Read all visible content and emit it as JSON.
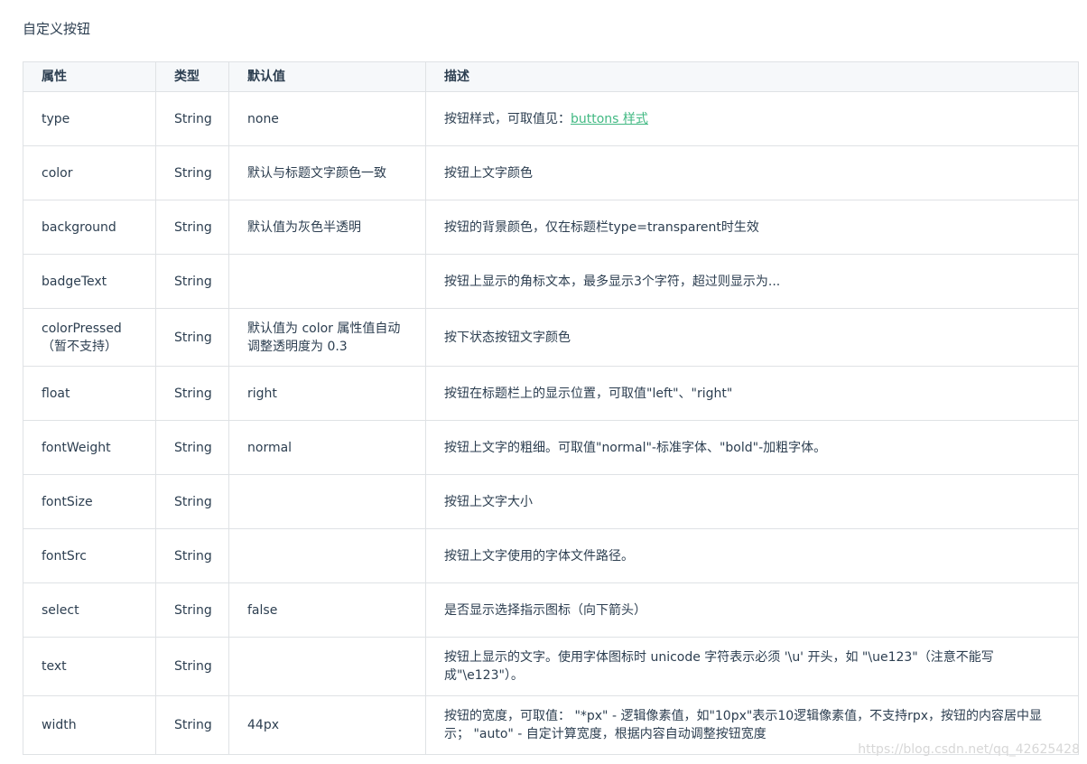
{
  "heading": "自定义按钮",
  "columns": [
    "属性",
    "类型",
    "默认值",
    "描述"
  ],
  "rows": [
    {
      "attr": "type",
      "type": "String",
      "default": "none",
      "desc": "按钮样式，可取值见：",
      "desc_link": "buttons 样式"
    },
    {
      "attr": "color",
      "type": "String",
      "default": "默认与标题文字颜色一致",
      "desc": "按钮上文字颜色"
    },
    {
      "attr": "background",
      "type": "String",
      "default": "默认值为灰色半透明",
      "desc": "按钮的背景颜色，仅在标题栏type=transparent时生效"
    },
    {
      "attr": "badgeText",
      "type": "String",
      "default": "",
      "desc": "按钮上显示的角标文本，最多显示3个字符，超过则显示为..."
    },
    {
      "attr": "colorPressed",
      "attr_note": "（暂不支持）",
      "type": "String",
      "default": "默认值为 color 属性值自动调整透明度为 0.3",
      "desc": "按下状态按钮文字颜色"
    },
    {
      "attr": "float",
      "type": "String",
      "default": "right",
      "desc": "按钮在标题栏上的显示位置，可取值\"left\"、\"right\""
    },
    {
      "attr": "fontWeight",
      "type": "String",
      "default": "normal",
      "desc": "按钮上文字的粗细。可取值\"normal\"-标准字体、\"bold\"-加粗字体。"
    },
    {
      "attr": "fontSize",
      "type": "String",
      "default": "",
      "desc": "按钮上文字大小"
    },
    {
      "attr": "fontSrc",
      "type": "String",
      "default": "",
      "desc": "按钮上文字使用的字体文件路径。"
    },
    {
      "attr": "select",
      "type": "String",
      "default": "false",
      "desc": "是否显示选择指示图标（向下箭头）"
    },
    {
      "attr": "text",
      "type": "String",
      "default": "",
      "desc": "按钮上显示的文字。使用字体图标时 unicode 字符表示必须 '\\u' 开头，如 \"\\ue123\"（注意不能写成\"\\e123\"）。"
    },
    {
      "attr": "width",
      "type": "String",
      "default": "44px",
      "desc": "按钮的宽度，可取值： \"*px\" - 逻辑像素值，如\"10px\"表示10逻辑像素值，不支持rpx，按钮的内容居中显示； \"auto\" - 自定计算宽度，根据内容自动调整按钮宽度"
    }
  ],
  "watermark": "https://blog.csdn.net/qq_42625428",
  "colors": {
    "link": "#42b983",
    "text": "#2c3e50",
    "header_bg": "#f6f8fa",
    "border": "#dfe2e5"
  }
}
